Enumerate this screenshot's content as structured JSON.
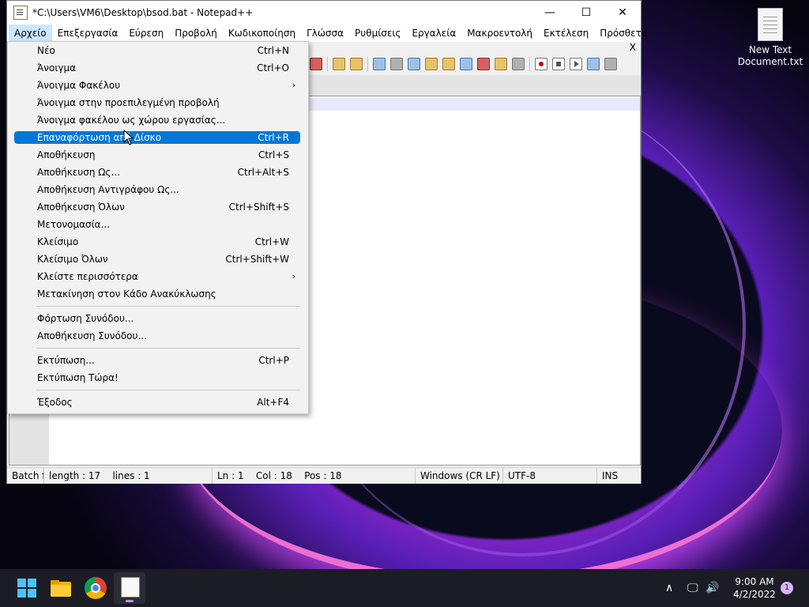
{
  "window": {
    "title": "*C:\\Users\\VM6\\Desktop\\bsod.bat - Notepad++",
    "minimize_glyph": "—",
    "maximize_glyph": "☐",
    "close_glyph": "✕",
    "tab_close": "X"
  },
  "menubar": {
    "items": [
      {
        "label": "Αρχείο"
      },
      {
        "label": "Επεξεργασία"
      },
      {
        "label": "Εύρεση"
      },
      {
        "label": "Προβολή"
      },
      {
        "label": "Κωδικοποίηση"
      },
      {
        "label": "Γλώσσα"
      },
      {
        "label": "Ρυθμίσεις"
      },
      {
        "label": "Εργαλεία"
      },
      {
        "label": "Μακροεντολή"
      },
      {
        "label": "Εκτέλεση"
      },
      {
        "label": "Πρόσθετα"
      }
    ]
  },
  "file_menu": {
    "items": [
      {
        "label": "Νέο",
        "shortcut": "Ctrl+N"
      },
      {
        "label": "Άνοιγμα",
        "shortcut": "Ctrl+O"
      },
      {
        "label": "Άνοιγμα Φακέλου",
        "shortcut": "",
        "submenu": "›"
      },
      {
        "label": "Άνοιγμα στην προεπιλεγμένη προβολή",
        "shortcut": ""
      },
      {
        "label": "Άνοιγμα φακέλου ως χώρου εργασίας...",
        "shortcut": ""
      },
      {
        "label": "Επαναφόρτωση από Δίσκο",
        "shortcut": "Ctrl+R"
      },
      {
        "label": "Αποθήκευση",
        "shortcut": "Ctrl+S"
      },
      {
        "label": "Αποθήκευση Ως...",
        "shortcut": "Ctrl+Alt+S"
      },
      {
        "label": "Αποθήκευση Αντιγράφου Ως...",
        "shortcut": ""
      },
      {
        "label": "Αποθήκευση Όλων",
        "shortcut": "Ctrl+Shift+S"
      },
      {
        "label": "Μετονομασία...",
        "shortcut": ""
      },
      {
        "label": "Κλείσιμο",
        "shortcut": "Ctrl+W"
      },
      {
        "label": "Κλείσιμο Όλων",
        "shortcut": "Ctrl+Shift+W"
      },
      {
        "label": "Κλείστε περισσότερα",
        "shortcut": "",
        "submenu": "›"
      },
      {
        "label": "Μετακίνηση στον Κάδο Ανακύκλωσης",
        "shortcut": ""
      },
      {
        "label": "Φόρτωση Συνόδου...",
        "shortcut": ""
      },
      {
        "label": "Αποθήκευση Συνόδου...",
        "shortcut": ""
      },
      {
        "label": "Εκτύπωση...",
        "shortcut": "Ctrl+P"
      },
      {
        "label": "Εκτύπωση Τώρα!",
        "shortcut": ""
      },
      {
        "label": "Έξοδος",
        "shortcut": "Alt+F4"
      }
    ]
  },
  "statusbar": {
    "filetype": "Batch fi",
    "length": "length : 17",
    "lines": "lines : 1",
    "ln": "Ln : 1",
    "col": "Col : 18",
    "pos": "Pos : 18",
    "eol": "Windows (CR LF)",
    "encoding": "UTF-8",
    "mode": "INS"
  },
  "desktop": {
    "icon_label_1": "New Text",
    "icon_label_2": "Document.txt"
  },
  "taskbar": {
    "time": "9:00 AM",
    "date": "4/2/2022",
    "notification_count": "1",
    "chevron": "∧",
    "network_glyph": "🖵",
    "volume_glyph": "🔊"
  },
  "colors": {
    "highlight": "#0078d7",
    "taskbar": "#1c1c24"
  }
}
